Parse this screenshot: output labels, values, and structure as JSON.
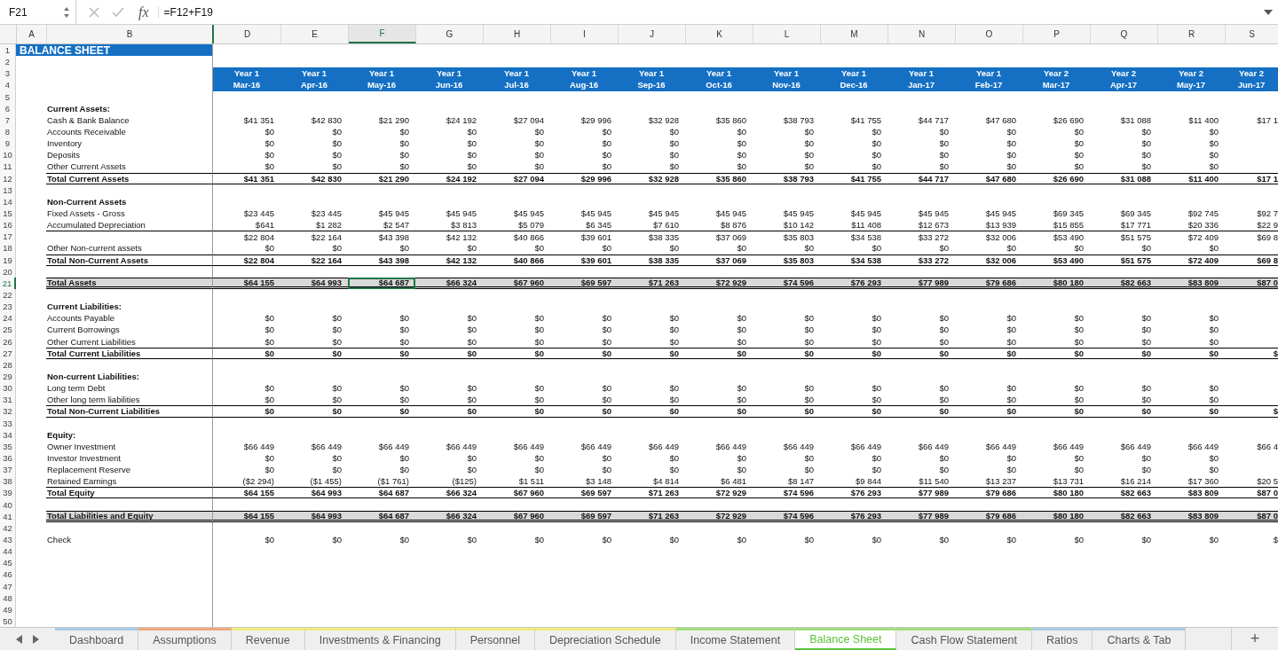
{
  "formula_bar": {
    "name_box": "F21",
    "function_label": "fx",
    "formula": "=F12+F19"
  },
  "label_columns": [
    {
      "letter": "A",
      "selected": false
    },
    {
      "letter": "B",
      "selected": false
    }
  ],
  "columns": [
    {
      "letter": "D",
      "year": "Year 1",
      "month": "Mar-16",
      "selected": false
    },
    {
      "letter": "E",
      "year": "Year 1",
      "month": "Apr-16",
      "selected": false
    },
    {
      "letter": "F",
      "year": "Year 1",
      "month": "May-16",
      "selected": true
    },
    {
      "letter": "G",
      "year": "Year 1",
      "month": "Jun-16",
      "selected": false
    },
    {
      "letter": "H",
      "year": "Year 1",
      "month": "Jul-16",
      "selected": false
    },
    {
      "letter": "I",
      "year": "Year 1",
      "month": "Aug-16",
      "selected": false
    },
    {
      "letter": "J",
      "year": "Year 1",
      "month": "Sep-16",
      "selected": false
    },
    {
      "letter": "K",
      "year": "Year 1",
      "month": "Oct-16",
      "selected": false
    },
    {
      "letter": "L",
      "year": "Year 1",
      "month": "Nov-16",
      "selected": false
    },
    {
      "letter": "M",
      "year": "Year 1",
      "month": "Dec-16",
      "selected": false
    },
    {
      "letter": "N",
      "year": "Year 1",
      "month": "Jan-17",
      "selected": false
    },
    {
      "letter": "O",
      "year": "Year 1",
      "month": "Feb-17",
      "selected": false
    },
    {
      "letter": "P",
      "year": "Year 2",
      "month": "Mar-17",
      "selected": false
    },
    {
      "letter": "Q",
      "year": "Year 2",
      "month": "Apr-17",
      "selected": false
    },
    {
      "letter": "R",
      "year": "Year 2",
      "month": "May-17",
      "selected": false
    },
    {
      "letter": "S",
      "year": "Year 2",
      "month": "Jun-17",
      "selected": false
    }
  ],
  "rows": [
    {
      "num": "1",
      "kind": "title",
      "label": "BALANCE SHEET",
      "selected": false
    },
    {
      "num": "2",
      "kind": "blank",
      "selected": false
    },
    {
      "num": "3",
      "kind": "year",
      "selected": false
    },
    {
      "num": "4",
      "kind": "month",
      "selected": false
    },
    {
      "num": "5",
      "kind": "blank",
      "selected": false
    },
    {
      "num": "6",
      "kind": "section",
      "label": "Current Assets:",
      "selected": false
    },
    {
      "num": "7",
      "kind": "item",
      "label": "Cash & Bank Balance",
      "selected": false,
      "values": [
        "$41 351",
        "$42 830",
        "$21 290",
        "$24 192",
        "$27 094",
        "$29 996",
        "$32 928",
        "$35 860",
        "$38 793",
        "$41 755",
        "$44 717",
        "$47 680",
        "$26 690",
        "$31 088",
        "$11 400",
        "$17 1"
      ]
    },
    {
      "num": "8",
      "kind": "item",
      "label": "Accounts Receivable",
      "selected": false,
      "values": [
        "$0",
        "$0",
        "$0",
        "$0",
        "$0",
        "$0",
        "$0",
        "$0",
        "$0",
        "$0",
        "$0",
        "$0",
        "$0",
        "$0",
        "$0"
      ]
    },
    {
      "num": "9",
      "kind": "item",
      "label": "Inventory",
      "selected": false,
      "values": [
        "$0",
        "$0",
        "$0",
        "$0",
        "$0",
        "$0",
        "$0",
        "$0",
        "$0",
        "$0",
        "$0",
        "$0",
        "$0",
        "$0",
        "$0"
      ]
    },
    {
      "num": "10",
      "kind": "item",
      "label": "Deposits",
      "selected": false,
      "values": [
        "$0",
        "$0",
        "$0",
        "$0",
        "$0",
        "$0",
        "$0",
        "$0",
        "$0",
        "$0",
        "$0",
        "$0",
        "$0",
        "$0",
        "$0"
      ]
    },
    {
      "num": "11",
      "kind": "item",
      "label": "Other Current Assets",
      "selected": false,
      "values": [
        "$0",
        "$0",
        "$0",
        "$0",
        "$0",
        "$0",
        "$0",
        "$0",
        "$0",
        "$0",
        "$0",
        "$0",
        "$0",
        "$0",
        "$0"
      ]
    },
    {
      "num": "12",
      "kind": "total",
      "label": "Total Current Assets",
      "selected": false,
      "values": [
        "$41 351",
        "$42 830",
        "$21 290",
        "$24 192",
        "$27 094",
        "$29 996",
        "$32 928",
        "$35 860",
        "$38 793",
        "$41 755",
        "$44 717",
        "$47 680",
        "$26 690",
        "$31 088",
        "$11 400",
        "$17 1"
      ]
    },
    {
      "num": "13",
      "kind": "blank",
      "selected": false
    },
    {
      "num": "14",
      "kind": "section",
      "label": "Non-Current Assets",
      "selected": false
    },
    {
      "num": "15",
      "kind": "item",
      "label": "Fixed Assets - Gross",
      "selected": false,
      "values": [
        "$23 445",
        "$23 445",
        "$45 945",
        "$45 945",
        "$45 945",
        "$45 945",
        "$45 945",
        "$45 945",
        "$45 945",
        "$45 945",
        "$45 945",
        "$45 945",
        "$69 345",
        "$69 345",
        "$92 745",
        "$92 7"
      ]
    },
    {
      "num": "16",
      "kind": "item",
      "label": "Accumulated Depreciation",
      "selected": false,
      "values": [
        "$641",
        "$1 282",
        "$2 547",
        "$3 813",
        "$5 079",
        "$6 345",
        "$7 610",
        "$8 876",
        "$10 142",
        "$11 408",
        "$12 673",
        "$13 939",
        "$15 855",
        "$17 771",
        "$20 336",
        "$22 9"
      ]
    },
    {
      "num": "17",
      "kind": "subtotal",
      "selected": false,
      "values": [
        "$22 804",
        "$22 164",
        "$43 398",
        "$42 132",
        "$40 866",
        "$39 601",
        "$38 335",
        "$37 069",
        "$35 803",
        "$34 538",
        "$33 272",
        "$32 006",
        "$53 490",
        "$51 575",
        "$72 409",
        "$69 8"
      ]
    },
    {
      "num": "18",
      "kind": "item",
      "label": "Other Non-current assets",
      "selected": false,
      "values": [
        "$0",
        "$0",
        "$0",
        "$0",
        "$0",
        "$0",
        "$0",
        "$0",
        "$0",
        "$0",
        "$0",
        "$0",
        "$0",
        "$0",
        "$0"
      ]
    },
    {
      "num": "19",
      "kind": "total",
      "label": "Total Non-Current Assets",
      "selected": false,
      "values": [
        "$22 804",
        "$22 164",
        "$43 398",
        "$42 132",
        "$40 866",
        "$39 601",
        "$38 335",
        "$37 069",
        "$35 803",
        "$34 538",
        "$33 272",
        "$32 006",
        "$53 490",
        "$51 575",
        "$72 409",
        "$69 8"
      ]
    },
    {
      "num": "20",
      "kind": "blank",
      "selected": false
    },
    {
      "num": "21",
      "kind": "grand",
      "label": "Total Assets",
      "selected": true,
      "values": [
        "$64 155",
        "$64 993",
        "$64 687",
        "$66 324",
        "$67 960",
        "$69 597",
        "$71 263",
        "$72 929",
        "$74 596",
        "$76 293",
        "$77 989",
        "$79 686",
        "$80 180",
        "$82 663",
        "$83 809",
        "$87 0"
      ]
    },
    {
      "num": "22",
      "kind": "blank",
      "selected": false
    },
    {
      "num": "23",
      "kind": "section",
      "label": "Current Liabilities:",
      "selected": false
    },
    {
      "num": "24",
      "kind": "item",
      "label": "Accounts Payable",
      "selected": false,
      "values": [
        "$0",
        "$0",
        "$0",
        "$0",
        "$0",
        "$0",
        "$0",
        "$0",
        "$0",
        "$0",
        "$0",
        "$0",
        "$0",
        "$0",
        "$0"
      ]
    },
    {
      "num": "25",
      "kind": "item",
      "label": "Current Borrowings",
      "selected": false,
      "values": [
        "$0",
        "$0",
        "$0",
        "$0",
        "$0",
        "$0",
        "$0",
        "$0",
        "$0",
        "$0",
        "$0",
        "$0",
        "$0",
        "$0",
        "$0"
      ]
    },
    {
      "num": "26",
      "kind": "item",
      "label": "Other Current Liabilities",
      "selected": false,
      "values": [
        "$0",
        "$0",
        "$0",
        "$0",
        "$0",
        "$0",
        "$0",
        "$0",
        "$0",
        "$0",
        "$0",
        "$0",
        "$0",
        "$0",
        "$0"
      ]
    },
    {
      "num": "27",
      "kind": "total",
      "label": "Total Current Liabilities",
      "selected": false,
      "values": [
        "$0",
        "$0",
        "$0",
        "$0",
        "$0",
        "$0",
        "$0",
        "$0",
        "$0",
        "$0",
        "$0",
        "$0",
        "$0",
        "$0",
        "$0",
        "$"
      ]
    },
    {
      "num": "28",
      "kind": "blank",
      "selected": false
    },
    {
      "num": "29",
      "kind": "section",
      "label": "Non-current Liabilities:",
      "selected": false
    },
    {
      "num": "30",
      "kind": "item",
      "label": "Long term Debt",
      "selected": false,
      "values": [
        "$0",
        "$0",
        "$0",
        "$0",
        "$0",
        "$0",
        "$0",
        "$0",
        "$0",
        "$0",
        "$0",
        "$0",
        "$0",
        "$0",
        "$0"
      ]
    },
    {
      "num": "31",
      "kind": "item",
      "label": "Other long term liabilities",
      "selected": false,
      "values": [
        "$0",
        "$0",
        "$0",
        "$0",
        "$0",
        "$0",
        "$0",
        "$0",
        "$0",
        "$0",
        "$0",
        "$0",
        "$0",
        "$0",
        "$0"
      ]
    },
    {
      "num": "32",
      "kind": "total",
      "label": "Total Non-Current Liabilities",
      "selected": false,
      "values": [
        "$0",
        "$0",
        "$0",
        "$0",
        "$0",
        "$0",
        "$0",
        "$0",
        "$0",
        "$0",
        "$0",
        "$0",
        "$0",
        "$0",
        "$0",
        "$"
      ]
    },
    {
      "num": "33",
      "kind": "blank",
      "selected": false
    },
    {
      "num": "34",
      "kind": "section",
      "label": "Equity:",
      "selected": false
    },
    {
      "num": "35",
      "kind": "item",
      "label": "Owner Investment",
      "selected": false,
      "values": [
        "$66 449",
        "$66 449",
        "$66 449",
        "$66 449",
        "$66 449",
        "$66 449",
        "$66 449",
        "$66 449",
        "$66 449",
        "$66 449",
        "$66 449",
        "$66 449",
        "$66 449",
        "$66 449",
        "$66 449",
        "$66 4"
      ]
    },
    {
      "num": "36",
      "kind": "item",
      "label": "Investor Investment",
      "selected": false,
      "values": [
        "$0",
        "$0",
        "$0",
        "$0",
        "$0",
        "$0",
        "$0",
        "$0",
        "$0",
        "$0",
        "$0",
        "$0",
        "$0",
        "$0",
        "$0"
      ]
    },
    {
      "num": "37",
      "kind": "item",
      "label": "Replacement Reserve",
      "selected": false,
      "values": [
        "$0",
        "$0",
        "$0",
        "$0",
        "$0",
        "$0",
        "$0",
        "$0",
        "$0",
        "$0",
        "$0",
        "$0",
        "$0",
        "$0",
        "$0"
      ]
    },
    {
      "num": "38",
      "kind": "item",
      "label": "Retained Earnings",
      "selected": false,
      "values": [
        "($2 294)",
        "($1 455)",
        "($1 761)",
        "($125)",
        "$1 511",
        "$3 148",
        "$4 814",
        "$6 481",
        "$8 147",
        "$9 844",
        "$11 540",
        "$13 237",
        "$13 731",
        "$16 214",
        "$17 360",
        "$20 5"
      ]
    },
    {
      "num": "39",
      "kind": "total",
      "label": "Total Equity",
      "selected": false,
      "values": [
        "$64 155",
        "$64 993",
        "$64 687",
        "$66 324",
        "$67 960",
        "$69 597",
        "$71 263",
        "$72 929",
        "$74 596",
        "$76 293",
        "$77 989",
        "$79 686",
        "$80 180",
        "$82 663",
        "$83 809",
        "$87 0"
      ]
    },
    {
      "num": "40",
      "kind": "blank",
      "selected": false
    },
    {
      "num": "41",
      "kind": "grand",
      "label": "Total Liabilities and Equity",
      "selected": false,
      "values": [
        "$64 155",
        "$64 993",
        "$64 687",
        "$66 324",
        "$67 960",
        "$69 597",
        "$71 263",
        "$72 929",
        "$74 596",
        "$76 293",
        "$77 989",
        "$79 686",
        "$80 180",
        "$82 663",
        "$83 809",
        "$87 0"
      ]
    },
    {
      "num": "42",
      "kind": "blank",
      "selected": false
    },
    {
      "num": "43",
      "kind": "item",
      "label": "Check",
      "selected": false,
      "values": [
        "$0",
        "$0",
        "$0",
        "$0",
        "$0",
        "$0",
        "$0",
        "$0",
        "$0",
        "$0",
        "$0",
        "$0",
        "$0",
        "$0",
        "$0",
        "$"
      ]
    },
    {
      "num": "44",
      "kind": "blank",
      "selected": false
    },
    {
      "num": "45",
      "kind": "blank",
      "selected": false
    },
    {
      "num": "46",
      "kind": "blank",
      "selected": false
    },
    {
      "num": "47",
      "kind": "blank",
      "selected": false
    },
    {
      "num": "48",
      "kind": "blank",
      "selected": false
    },
    {
      "num": "49",
      "kind": "blank",
      "selected": false
    },
    {
      "num": "50",
      "kind": "blank",
      "selected": false
    }
  ],
  "tabs": [
    {
      "label": "Dashboard",
      "color": "#a9cbe6",
      "selected": false
    },
    {
      "label": "Assumptions",
      "color": "#f2a57c",
      "selected": false
    },
    {
      "label": "Revenue",
      "color": "#f2ec7c",
      "selected": false
    },
    {
      "label": "Investments & Financing",
      "color": "#f2ec7c",
      "selected": false
    },
    {
      "label": "Personnel",
      "color": "#f2ec7c",
      "selected": false
    },
    {
      "label": "Depreciation Schedule",
      "color": "#f2ec7c",
      "selected": false
    },
    {
      "label": "Income Statement",
      "color": "#9ee07a",
      "selected": false
    },
    {
      "label": "Balance Sheet",
      "color": "#9ee07a",
      "selected": true
    },
    {
      "label": "Cash Flow Statement",
      "color": "#9ee07a",
      "selected": false
    },
    {
      "label": "Ratios",
      "color": "#a9cbe6",
      "selected": false
    },
    {
      "label": "Charts & Tab",
      "color": "#a9cbe6",
      "selected": false
    }
  ],
  "add_sheet": "+"
}
